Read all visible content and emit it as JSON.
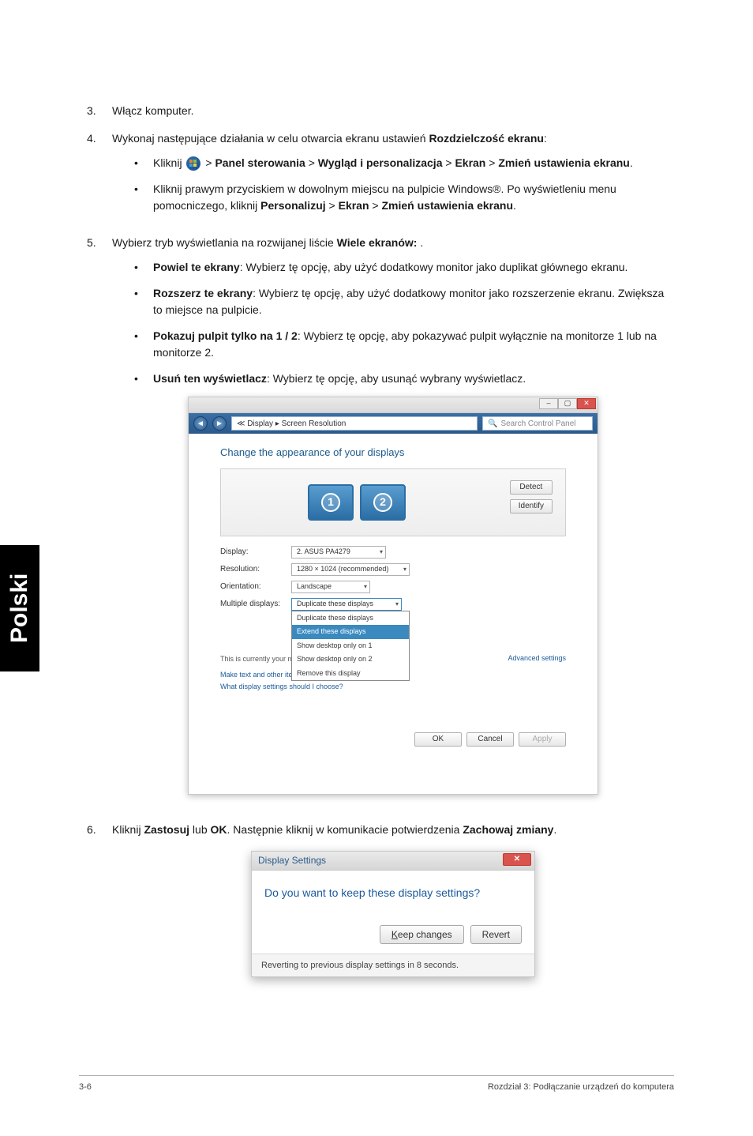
{
  "side_tab": "Polski",
  "list": {
    "item3": {
      "num": "3.",
      "text": "Włącz komputer."
    },
    "item4": {
      "num": "4.",
      "lead": "Wykonaj następujące działania w celu otwarcia ekranu ustawień ",
      "bold_tail": "Rozdzielczość ekranu",
      "colon": ":",
      "sub_a": {
        "pre": "Kliknij ",
        "seg1": "Panel sterowania",
        "seg2": "Wygląd i personalizacja",
        "seg3": "Ekran",
        "seg4": "Zmień ustawienia ekranu",
        "gt": " > "
      },
      "sub_b": {
        "line1": "Kliknij prawym przyciskiem w dowolnym miejscu na pulpicie Windows®. Po wyświetleniu menu pomocniczego, kliknij ",
        "b1": "Personalizuj",
        "b2": "Ekran",
        "b3": "Zmień ustawienia ekranu",
        "gt": " > "
      }
    },
    "item5": {
      "num": "5.",
      "lead": "Wybierz tryb wyświetlania na rozwijanej liście ",
      "bold": "Wiele ekranów:",
      "tail": " .",
      "opt1": {
        "b": "Powiel te ekrany",
        "rest": ": Wybierz tę opcję, aby użyć dodatkowy monitor jako duplikat głównego ekranu."
      },
      "opt2": {
        "b": "Rozszerz te ekrany",
        "rest": ": Wybierz tę opcję, aby użyć dodatkowy monitor jako rozszerzenie ekranu. Zwiększa to miejsce na pulpicie."
      },
      "opt3": {
        "b": "Pokazuj pulpit tylko na 1 / 2",
        "rest": ": Wybierz tę opcję, aby pokazywać pulpit wyłącznie na monitorze 1 lub na monitorze 2."
      },
      "opt4": {
        "b": "Usuń ten wyświetlacz",
        "rest": ": Wybierz tę opcję, aby usunąć wybrany wyświetlacz."
      }
    },
    "item6": {
      "num": "6.",
      "p1": "Kliknij ",
      "b1": "Zastosuj",
      "p2": " lub ",
      "b2": "OK",
      "p3": ". Następnie kliknij w komunikacie potwierdzenia ",
      "b3": "Zachowaj zmiany",
      "p4": "."
    }
  },
  "shot1": {
    "addr_pre": "≪ Display ▸ Screen Resolution",
    "search_placeholder": "Search Control Panel",
    "heading": "Change the appearance of your displays",
    "mon1": "1",
    "mon2": "2",
    "btn_detect": "Detect",
    "btn_identify": "Identify",
    "rows": {
      "display_lbl": "Display:",
      "display_val": "2. ASUS PA4279",
      "res_lbl": "Resolution:",
      "res_val": "1280 × 1024 (recommended)",
      "orient_lbl": "Orientation:",
      "orient_val": "Landscape",
      "multi_lbl": "Multiple displays:",
      "multi_val": "Duplicate these displays"
    },
    "dd": {
      "a": "Duplicate these displays",
      "b": "Extend these displays",
      "c": "Show desktop only on 1",
      "d": "Show desktop only on 2",
      "e": "Remove this display"
    },
    "warn": "This is currently your main display.",
    "advanced": "Advanced settings",
    "link1": "Make text and other items larger or smaller",
    "link2": "What display settings should I choose?",
    "btn_ok": "OK",
    "btn_cancel": "Cancel",
    "btn_apply": "Apply"
  },
  "shot2": {
    "title": "Display Settings",
    "close": "✕",
    "msg": "Do you want to keep these display settings?",
    "keep_u": "K",
    "keep_rest": "eep changes",
    "revert": "Revert",
    "footer": "Reverting to previous display settings in 8 seconds."
  },
  "footer": {
    "left": "3-6",
    "right": "Rozdział 3: Podłączanie urządzeń do komputera"
  }
}
